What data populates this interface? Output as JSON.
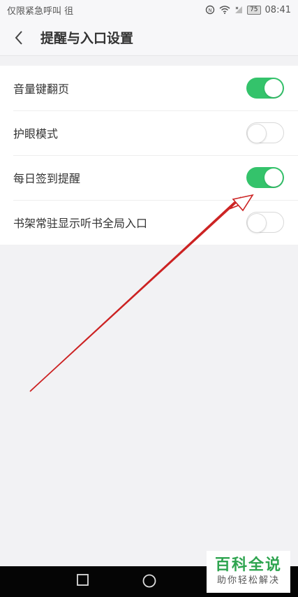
{
  "status_bar": {
    "carrier": "仅限紧急呼叫 徂",
    "battery": "75",
    "time": "08:41"
  },
  "header": {
    "title": "提醒与入口设置"
  },
  "settings": [
    {
      "label": "音量键翻页",
      "state": "on"
    },
    {
      "label": "护眼模式",
      "state": "off"
    },
    {
      "label": "每日签到提醒",
      "state": "on"
    },
    {
      "label": "书架常驻显示听书全局入口",
      "state": "off"
    }
  ],
  "colors": {
    "toggle_on": "#34c36b",
    "annotation_arrow": "#cc2222",
    "watermark_green": "#2ea44f"
  },
  "watermark": {
    "title": "百科全说",
    "subtitle": "助你轻松解决"
  }
}
